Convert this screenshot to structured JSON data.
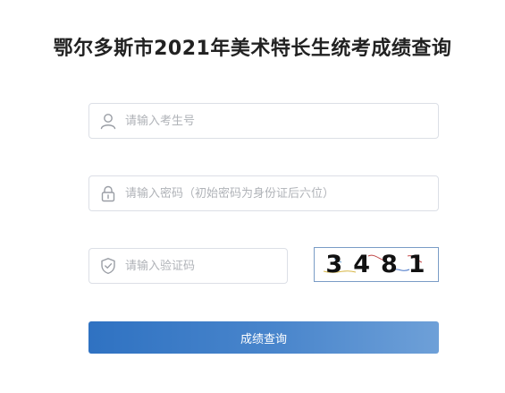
{
  "page": {
    "title": "鄂尔多斯市2021年美术特长生统考成绩查询"
  },
  "form": {
    "exam_number": {
      "placeholder": "请输入考生号",
      "value": "",
      "icon": "user-icon"
    },
    "password": {
      "placeholder": "请输入密码（初始密码为身份证后六位）",
      "value": "",
      "icon": "lock-icon"
    },
    "captcha_input": {
      "placeholder": "请输入验证码",
      "value": "",
      "icon": "shield-check-icon"
    },
    "captcha_image": {
      "code": "3481"
    },
    "submit_label": "成绩查询"
  },
  "colors": {
    "button_gradient_start": "#2f72c2",
    "button_gradient_end": "#6ea0d8",
    "input_border": "#dcdfe6",
    "placeholder": "#b0b3b8",
    "title": "#222222"
  }
}
